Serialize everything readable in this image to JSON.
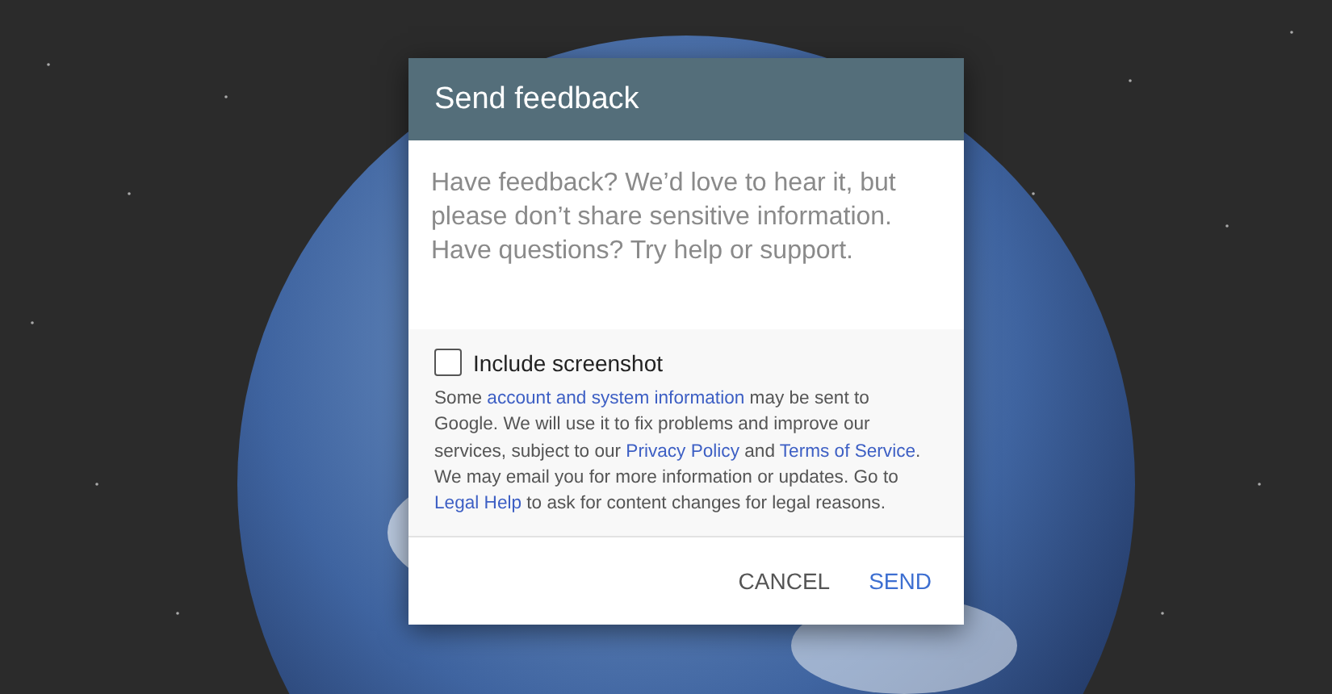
{
  "dialog": {
    "title": "Send feedback",
    "feedback_field": {
      "placeholder": "Have feedback? We’d love to hear it, but please don’t share sensitive information. Have questions? Try help or support."
    },
    "include_screenshot": {
      "label": "Include screenshot",
      "checked": false
    },
    "disclaimer": [
      {
        "kind": "text",
        "text": "Some "
      },
      {
        "kind": "link",
        "text": "account and system information"
      },
      {
        "kind": "text",
        "text": " may be sent to Google. We will use it to fix problems and improve our services, subject to our "
      },
      {
        "kind": "link",
        "text": "Privacy Policy"
      },
      {
        "kind": "text",
        "text": " and "
      },
      {
        "kind": "link",
        "text": "Terms of Service"
      },
      {
        "kind": "text",
        "text": ". We may email you for more information or updates. Go to "
      },
      {
        "kind": "link",
        "text": "Legal Help"
      },
      {
        "kind": "text",
        "text": " to ask for content changes for legal reasons."
      }
    ],
    "buttons": [
      {
        "label": "CANCEL",
        "kind": "secondary"
      },
      {
        "label": "SEND",
        "kind": "primary"
      }
    ]
  }
}
